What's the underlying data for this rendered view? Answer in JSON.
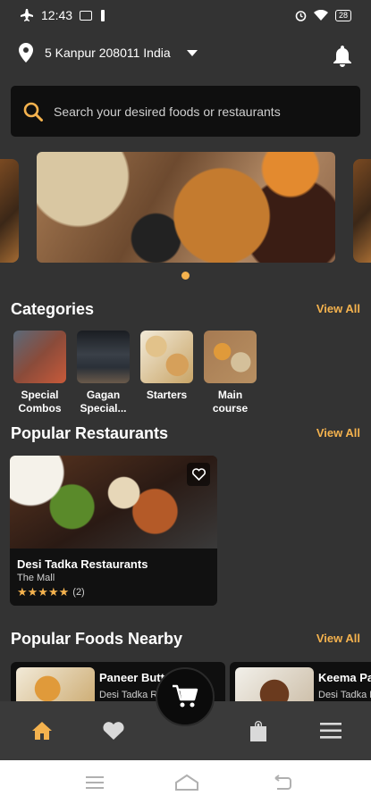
{
  "status_bar": {
    "time": "12:43",
    "battery": "28"
  },
  "header": {
    "location": "5 Kanpur 208011 India"
  },
  "search": {
    "placeholder": "Search your desired foods or restaurants"
  },
  "categories": {
    "title": "Categories",
    "view_all": "View All",
    "items": [
      {
        "label": "Special Combos",
        "color": "#8a4b3a"
      },
      {
        "label": "Gagan Special...",
        "color": "#2a3038"
      },
      {
        "label": "Starters",
        "color": "#c8a466"
      },
      {
        "label": "Main course",
        "color": "#b89062"
      }
    ]
  },
  "popular_restaurants": {
    "title": "Popular Restaurants",
    "view_all": "View All",
    "items": [
      {
        "name": "Desi Tadka Restaurants",
        "location": "The Mall",
        "rating": 5,
        "stars": "★★★★★",
        "reviews": "(2)"
      }
    ]
  },
  "popular_foods": {
    "title": "Popular Foods Nearby",
    "view_all": "View All",
    "items": [
      {
        "name": "Paneer Butter",
        "restaurant": "Desi Tadka Re"
      },
      {
        "name": "Keema Pa",
        "restaurant": "Desi Tadka Re"
      }
    ]
  },
  "nav": {
    "items": [
      "home-icon",
      "heart-icon",
      "cart-icon",
      "bag-icon",
      "menu-icon"
    ],
    "active": "home-icon"
  },
  "colors": {
    "accent": "#f4b24e",
    "background": "#333333",
    "card": "#0f0f0f"
  }
}
